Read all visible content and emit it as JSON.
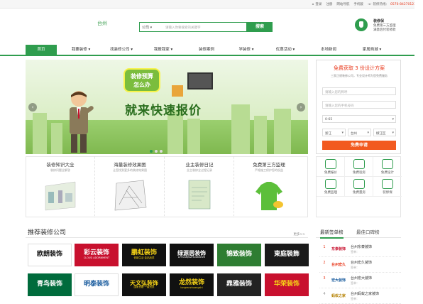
{
  "topbar": {
    "links": [
      "登录",
      "注册",
      "网站导航",
      "手机版"
    ],
    "hotline_label": "装修热线：",
    "hotline": "0576-84270123"
  },
  "header": {
    "city": "台州",
    "search": {
      "category": "公司",
      "placeholder": "请输入你要搜索的关键字",
      "button": "搜索"
    },
    "guard": {
      "title": "装修保",
      "lines": [
        "免费第三方监理",
        "满意后付装修款"
      ]
    }
  },
  "nav": {
    "items": [
      "首页",
      "我要装修",
      "找装修公司",
      "我报我家",
      "装修案例",
      "学装修",
      "优惠活动",
      "本地新闻",
      "家居商城"
    ]
  },
  "banner": {
    "sign_line1": "装修预算",
    "sign_line2": "怎么办",
    "slogan": "就来快速报价",
    "prev": "‹",
    "next": "›"
  },
  "form": {
    "title": "免费获取 3 份设计方案",
    "subtitle": "三家正规装修公司，专业设计师为您免费服务",
    "name_placeholder": "请输入您的称呼",
    "phone_placeholder": "请输入您的手机号码",
    "area": "0-65",
    "province": "浙江",
    "city": "台州",
    "district": "椒江区",
    "submit": "免费申请"
  },
  "features": [
    {
      "title": "装修知识大全",
      "sub": "装修问题全解答"
    },
    {
      "title": "海量装修效果图",
      "sub": "让您找到更多的装修效果图"
    },
    {
      "title": "业主装修日记",
      "sub": "业主装修全过程记录"
    },
    {
      "title": "免费第三方监理",
      "sub": "严格施工保护您的权益"
    }
  ],
  "quick_grid": [
    "免费报价",
    "免费验房",
    "免费设计",
    "免费监理",
    "免费量房",
    "装修保"
  ],
  "companies": {
    "heading": "推荐装修公司",
    "more": "更多>>",
    "logos": [
      {
        "name": "欧朗装饰",
        "bg": "#ffffff",
        "fg": "#111111"
      },
      {
        "name": "彩云装饰",
        "sub": "CLOUD ADORNMENT",
        "bg": "#c8102e",
        "fg": "#ffffff"
      },
      {
        "name": "鹏虹装饰",
        "sub": "低碳生活 金钻品质",
        "bg": "#111111",
        "fg": "#f7d417"
      },
      {
        "name": "绿源居装饰",
        "sub": "LVYUANJUZHUANGSHI",
        "bg": "#111111",
        "fg": "#ffffff"
      },
      {
        "name": "锦致装饰",
        "bg": "#2e7d32",
        "fg": "#ffffff"
      },
      {
        "name": "東庭裝飾",
        "bg": "#1a1a1a",
        "fg": "#ffffff"
      },
      {
        "name": "青鸟装饰",
        "bg": "#006b3c",
        "fg": "#ffffff"
      },
      {
        "name": "明泰装饰",
        "bg": "#ffffff",
        "fg": "#1a5c9e"
      },
      {
        "name": "天文弘装饰",
        "sub": "国家资格·一级资质",
        "bg": "#111111",
        "fg": "#f7d417"
      },
      {
        "name": "龙然装饰",
        "sub": "longranzhuangshi",
        "bg": "#111111",
        "fg": "#f7d417"
      },
      {
        "name": "鼎雅装饰",
        "bg": "#222222",
        "fg": "#ffffff"
      },
      {
        "name": "华荣装饰",
        "bg": "#c8102e",
        "fg": "#f7d417"
      }
    ]
  },
  "ranking": {
    "tabs": [
      "最新签单榜",
      "最佳口碑榜"
    ],
    "rows": [
      {
        "num": "1",
        "logo": "东泰装饰",
        "name": "台州东泰装饰",
        "sub": "签单：",
        "color": "#c8102e"
      },
      {
        "num": "2",
        "logo": "台州宏久",
        "name": "台州宏久装饰",
        "sub": "签单：",
        "color": "#e8381b"
      },
      {
        "num": "3",
        "logo": "宏大装饰",
        "name": "台州宏大装饰",
        "sub": "签单：",
        "color": "#1a5c9e"
      },
      {
        "num": "4",
        "logo": "蚂蚁之家",
        "name": "台州蚂蚁之家装饰",
        "sub": "签单：",
        "color": "#b8860b"
      }
    ]
  }
}
